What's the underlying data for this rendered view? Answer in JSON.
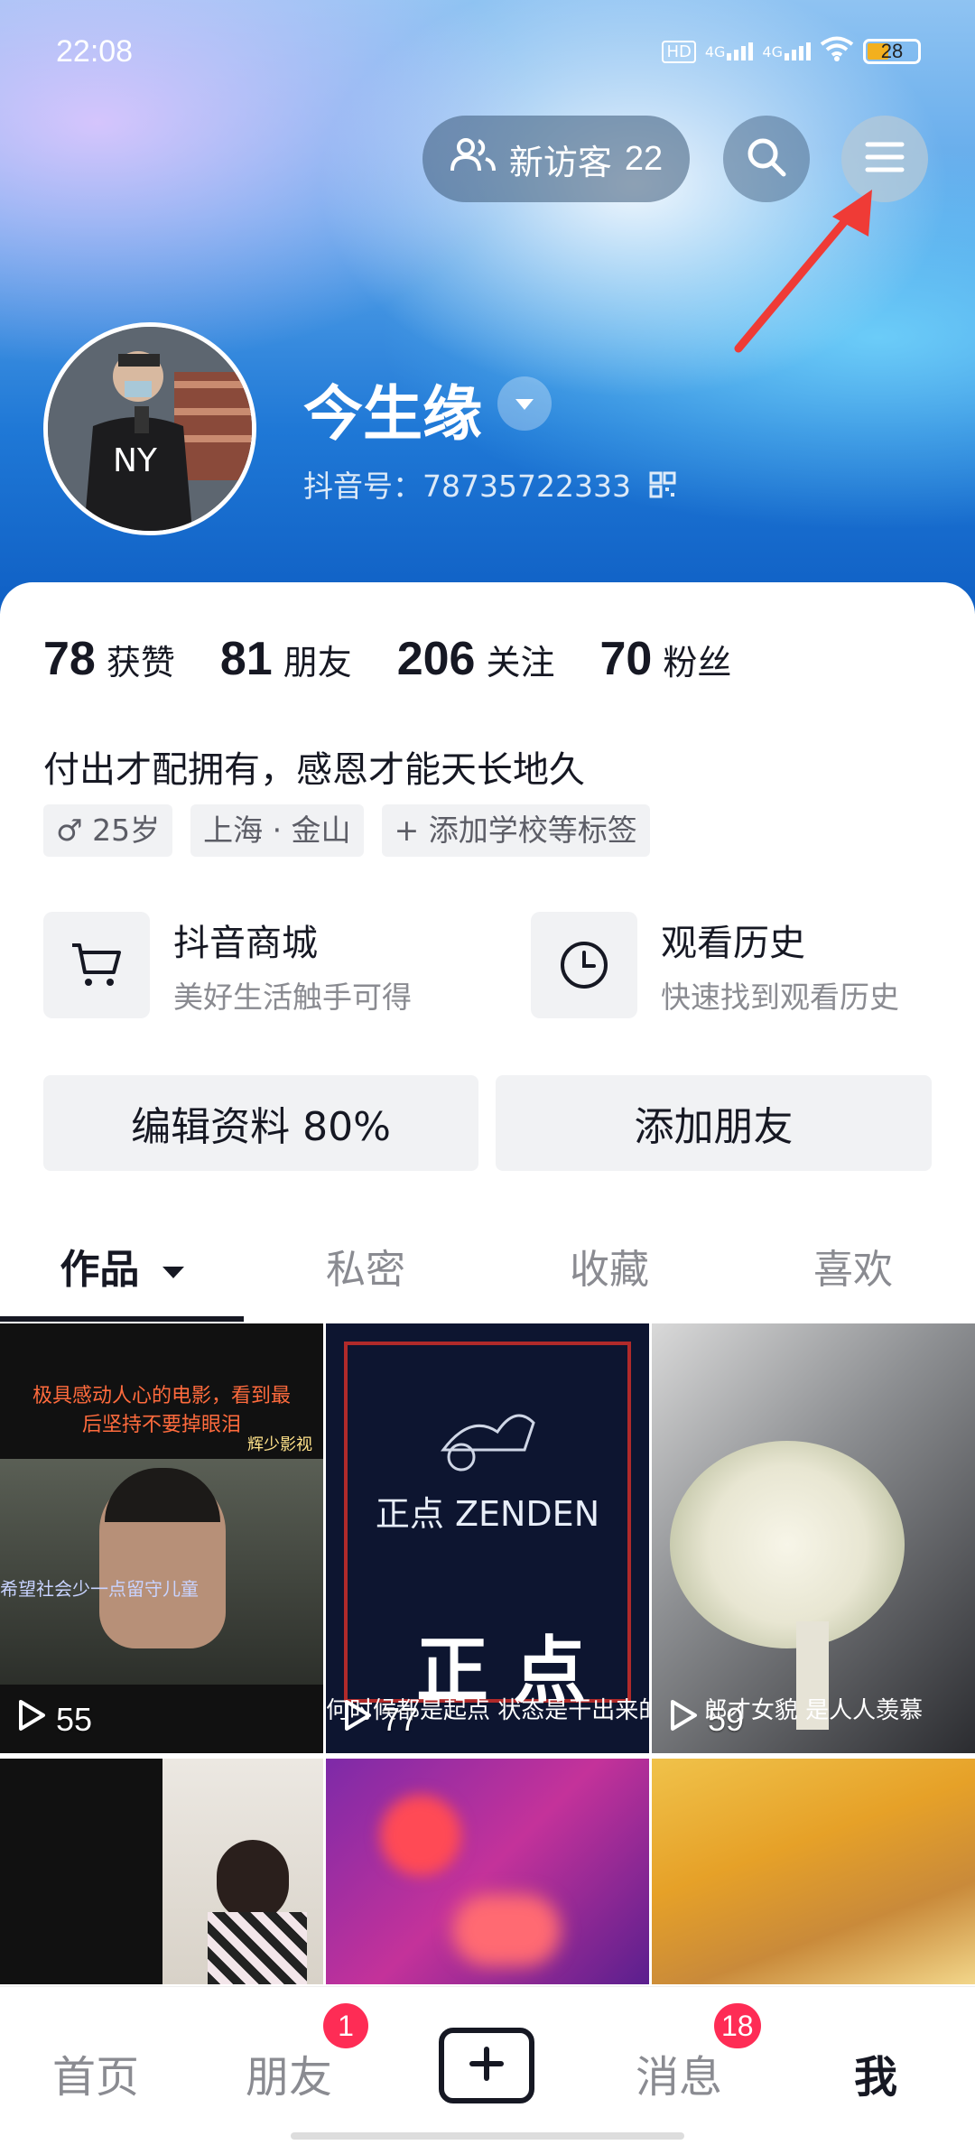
{
  "status_bar": {
    "time": "22:08",
    "network_1": "4G",
    "network_2": "4G",
    "hd": "HD",
    "battery": "28"
  },
  "header": {
    "visitor_label": "新访客",
    "visitor_count": "22",
    "username": "今生缘",
    "uid": "抖音号：78735722333"
  },
  "stats": [
    {
      "num": "78",
      "label": "获赞"
    },
    {
      "num": "81",
      "label": "朋友"
    },
    {
      "num": "206",
      "label": "关注"
    },
    {
      "num": "70",
      "label": "粉丝"
    }
  ],
  "bio": "付出才配拥有，感恩才能天长地久",
  "tags": {
    "gender_age": "♂ 25岁",
    "location": "上海 · 金山",
    "add_tag": "+ 添加学校等标签"
  },
  "quick_entries": [
    {
      "title": "抖音商城",
      "subtitle": "美好生活触手可得"
    },
    {
      "title": "观看历史",
      "subtitle": "快速找到观看历史"
    }
  ],
  "buttons": {
    "edit_profile": "编辑资料 80%",
    "add_friend": "添加朋友"
  },
  "tabs": [
    "作品",
    "私密",
    "收藏",
    "喜欢"
  ],
  "videos": [
    {
      "plays": "55",
      "caption_top": "极具感动人心的电影，看到最后坚持不要掉眼泪",
      "caption_mid": "希望社会少一点留守儿童",
      "brand": "辉少影视"
    },
    {
      "plays": "77",
      "caption_mid": "何时候都是起点 状态是干出来的",
      "brand": "正点 ZENDEN"
    },
    {
      "plays": "59",
      "caption_mid": "郎才女貌 是人人羡慕"
    },
    {
      "plays": ""
    },
    {
      "plays": ""
    },
    {
      "plays": ""
    }
  ],
  "bottom_nav": {
    "home": "首页",
    "friends": "朋友",
    "friends_badge": "1",
    "messages": "消息",
    "messages_badge": "18",
    "me": "我"
  }
}
